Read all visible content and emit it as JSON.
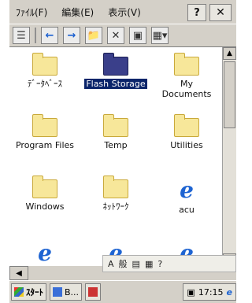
{
  "menubar": {
    "file": "ﾌｧｲﾙ(F)",
    "edit": "編集(E)",
    "view": "表示(V)",
    "help": "?",
    "close": "✕"
  },
  "toolbar": {
    "view_icon": "view-icon",
    "back_icon": "back-icon",
    "forward_icon": "forward-icon",
    "up_icon": "up-folder-icon",
    "delete_icon": "delete-icon",
    "properties_icon": "properties-icon",
    "views_icon": "views-icon"
  },
  "items": [
    {
      "label": "ﾃﾞｰﾀﾍﾞｰｽ",
      "icon": "database-folder-icon"
    },
    {
      "label": "Flash Storage",
      "icon": "flash-storage-icon",
      "selected": true
    },
    {
      "label": "My Documents",
      "icon": "folder-icon"
    },
    {
      "label": "Program Files",
      "icon": "folder-icon"
    },
    {
      "label": "Temp",
      "icon": "folder-icon"
    },
    {
      "label": "Utilities",
      "icon": "folder-icon"
    },
    {
      "label": "Windows",
      "icon": "folder-icon"
    },
    {
      "label": "ﾈｯﾄﾜｰｸ",
      "icon": "network-folder-icon"
    },
    {
      "label": "acu",
      "icon": "internet-explorer-icon"
    }
  ],
  "ime": {
    "mode": "A",
    "kana": "般"
  },
  "taskbar": {
    "start_label": "ｽﾀｰﾄ",
    "task1_label": "B...",
    "clock": "17:15"
  }
}
